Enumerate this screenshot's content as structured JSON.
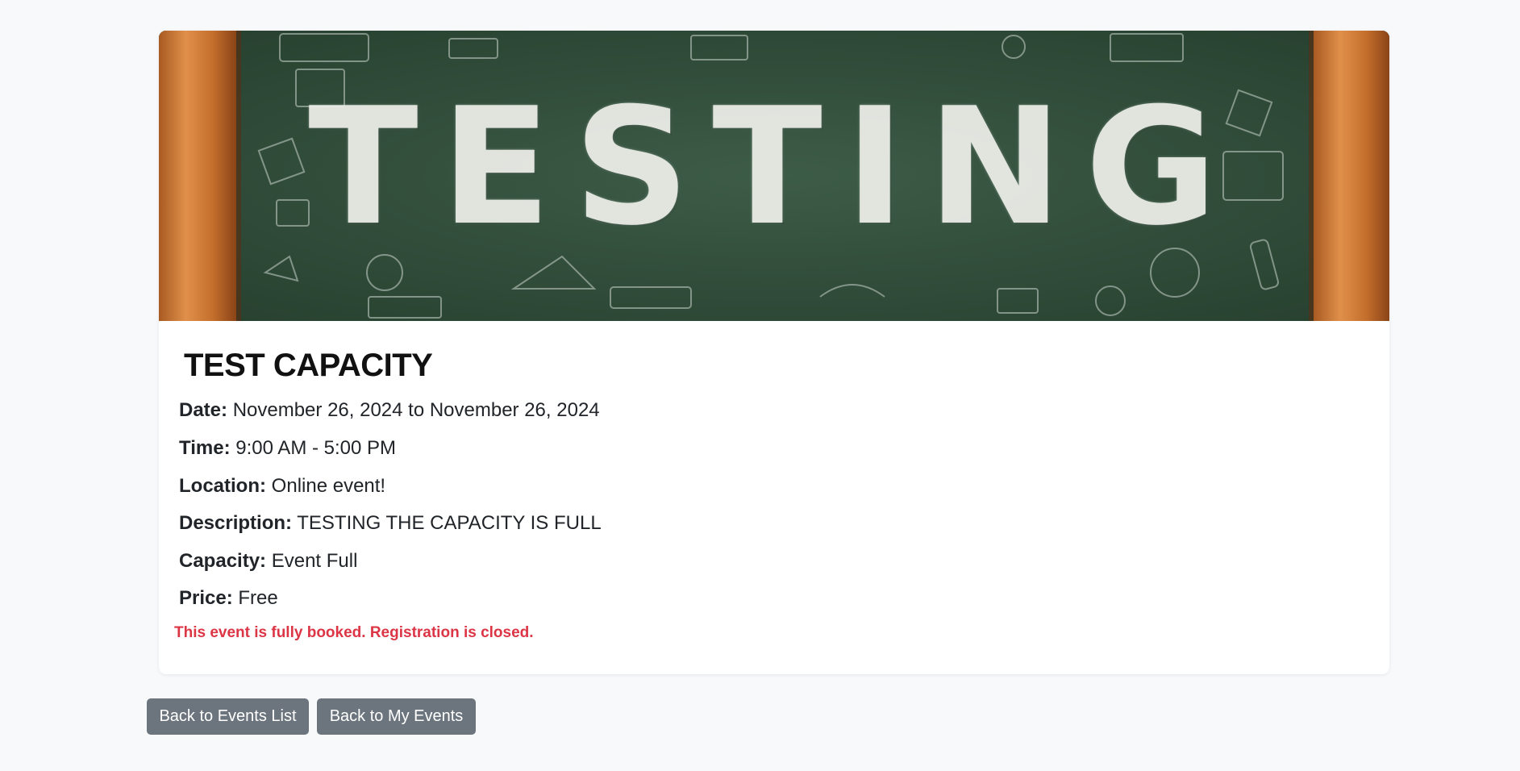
{
  "banner": {
    "word": "TESTING",
    "colors": {
      "board": "#2f4a38",
      "frame": "#c8742f",
      "chalk": "#eef0ea"
    }
  },
  "event": {
    "title": "TEST CAPACITY",
    "details": [
      {
        "label": "Date:",
        "value": "November 26, 2024 to November 26, 2024"
      },
      {
        "label": "Time:",
        "value": "9:00 AM - 5:00 PM"
      },
      {
        "label": "Location:",
        "value": "Online event!"
      },
      {
        "label": "Description:",
        "value": "TESTING THE CAPACITY IS FULL"
      },
      {
        "label": "Capacity:",
        "value": "Event Full"
      },
      {
        "label": "Price:",
        "value": "Free"
      }
    ],
    "notice": "This event is fully booked. Registration is closed."
  },
  "actions": {
    "back_events": "Back to Events List",
    "back_my_events": "Back to My Events"
  },
  "colors": {
    "page_bg": "#f8f9fa",
    "notice": "#dc3545",
    "button": "#6c757d"
  }
}
